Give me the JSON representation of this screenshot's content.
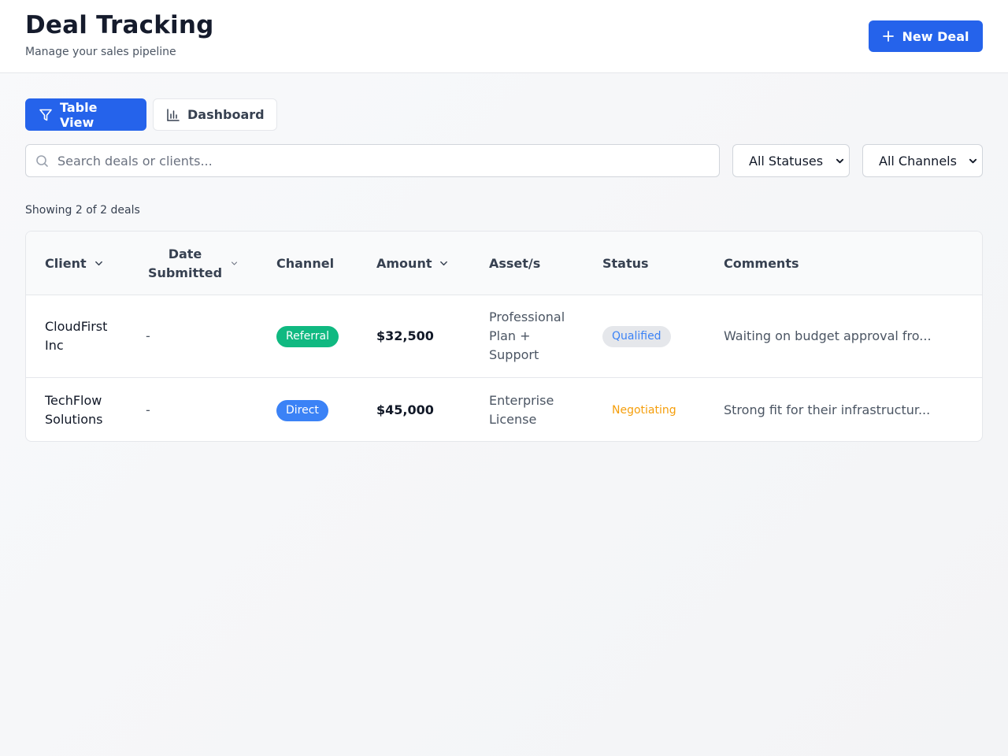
{
  "header": {
    "title": "Deal Tracking",
    "subtitle": "Manage your sales pipeline",
    "new_deal_label": "New Deal"
  },
  "tabs": [
    {
      "label": "Table View",
      "icon": "filter-icon",
      "active": true
    },
    {
      "label": "Dashboard",
      "icon": "bar-chart-icon",
      "active": false
    }
  ],
  "filters": {
    "search_placeholder": "Search deals or clients...",
    "search_value": "",
    "status_selected": "All Statuses",
    "channel_selected": "All Channels"
  },
  "summary": {
    "count_text": "Showing 2 of 2 deals"
  },
  "table": {
    "columns": [
      {
        "label": "Client",
        "sortable": true
      },
      {
        "label": "Date Submitted",
        "sortable": true
      },
      {
        "label": "Channel",
        "sortable": false
      },
      {
        "label": "Amount",
        "sortable": true
      },
      {
        "label": "Asset/s",
        "sortable": false
      },
      {
        "label": "Status",
        "sortable": false
      },
      {
        "label": "Comments",
        "sortable": false
      }
    ],
    "rows": [
      {
        "client": "CloudFirst Inc",
        "date_submitted": "-",
        "channel": "Referral",
        "amount": "$32,500",
        "assets": "Professional Plan + Support",
        "status": "Qualified",
        "comments": "Waiting on budget approval fro..."
      },
      {
        "client": "TechFlow Solutions",
        "date_submitted": "-",
        "channel": "Direct",
        "amount": "$45,000",
        "assets": "Enterprise License",
        "status": "Negotiating",
        "comments": "Strong fit for their infrastructur..."
      }
    ]
  },
  "colors": {
    "primary": "#2563eb",
    "referral": "#10b981",
    "direct": "#3b82f6",
    "qualified_bg": "#e5e7eb",
    "negotiating": "#f59e0b"
  }
}
